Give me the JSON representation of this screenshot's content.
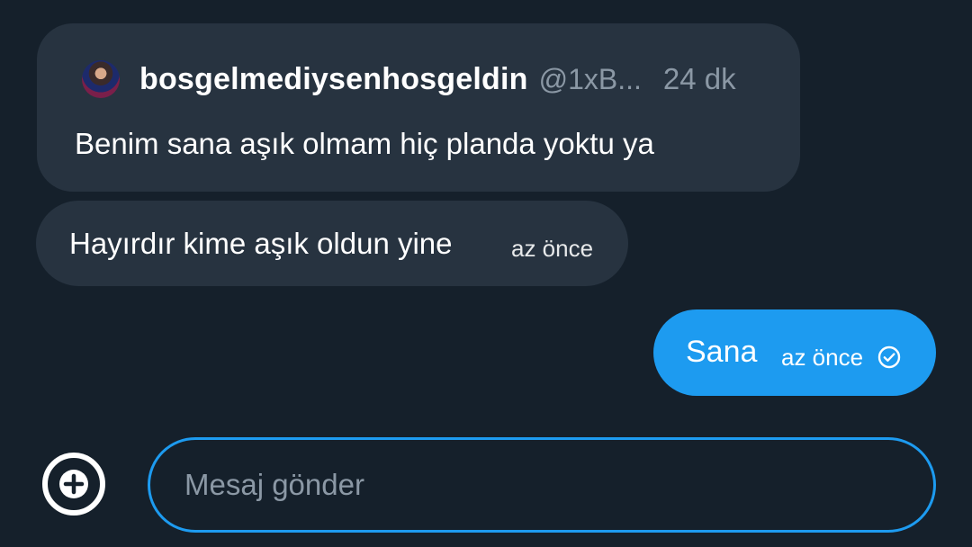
{
  "quote": {
    "author_name": "bosgelmediysenhosgeldin",
    "author_handle": "@1xB...",
    "time": "24 dk",
    "text": "Benim sana aşık olmam hiç planda yoktu ya"
  },
  "messages": [
    {
      "direction": "received",
      "text": "Hayırdır kime aşık oldun yine",
      "time": "az önce"
    },
    {
      "direction": "sent",
      "text": "Sana",
      "time": "az önce",
      "status_icon": "check-circle-icon"
    }
  ],
  "composer": {
    "placeholder": "Mesaj gönder",
    "value": "",
    "add_icon": "plus-circle-icon"
  },
  "colors": {
    "background": "#15202b",
    "bubble_received": "#273340",
    "bubble_sent": "#1d9bf0",
    "accent": "#1d9bf0",
    "secondary_text": "#8b98a5"
  }
}
